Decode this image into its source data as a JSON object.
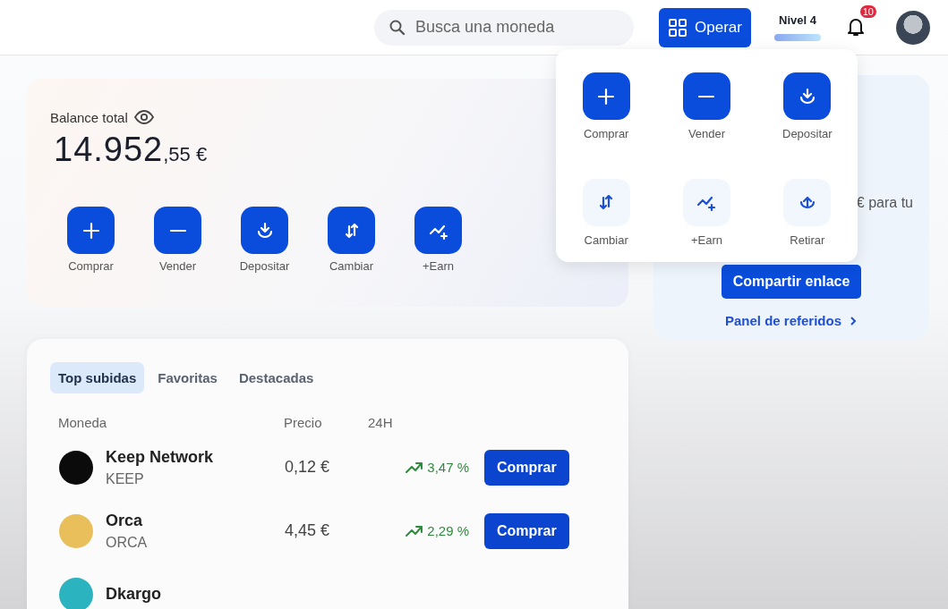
{
  "header": {
    "search": {
      "placeholder": "Busca una moneda"
    },
    "operate_button": "Operar",
    "level_label": "Nivel 4",
    "notifications": "10"
  },
  "balance": {
    "label": "Balance total",
    "amount": "14.952",
    "decimals": ",55 €",
    "actions": [
      {
        "kind": "plus",
        "label": "Comprar"
      },
      {
        "kind": "minus",
        "label": "Vender"
      },
      {
        "kind": "deposit",
        "label": "Depositar"
      },
      {
        "kind": "swap",
        "label": "Cambiar"
      },
      {
        "kind": "earn",
        "label": "+Earn"
      }
    ]
  },
  "operate_menu": [
    {
      "kind": "plus",
      "label": "Comprar",
      "filled": true
    },
    {
      "kind": "minus",
      "label": "Vender",
      "filled": true
    },
    {
      "kind": "deposit",
      "label": "Depositar",
      "filled": true
    },
    {
      "kind": "swap",
      "label": "Cambiar",
      "filled": false
    },
    {
      "kind": "earn",
      "label": "+Earn",
      "filled": false
    },
    {
      "kind": "withdraw",
      "label": "Retirar",
      "filled": false
    }
  ],
  "referral": {
    "text": "€ para tu",
    "button": "Compartir enlace",
    "link": "Panel de referidos"
  },
  "market": {
    "tabs": [
      {
        "label": "Top subidas",
        "selected": true
      },
      {
        "label": "Favoritas",
        "selected": false
      },
      {
        "label": "Destacadas",
        "selected": false
      }
    ],
    "columns": [
      "Moneda",
      "Precio",
      "24H"
    ],
    "rows": [
      {
        "name": "Keep Network",
        "ticker": "KEEP",
        "price": "0,12 €",
        "change": "3,47 %",
        "button": "Comprar",
        "color": "#0b0b0b"
      },
      {
        "name": "Orca",
        "ticker": "ORCA",
        "price": "4,45 €",
        "change": "2,29 %",
        "button": "Comprar",
        "color": "#e8bf5a"
      },
      {
        "name": "Dkargo",
        "color": "#2bb3c0"
      }
    ]
  }
}
